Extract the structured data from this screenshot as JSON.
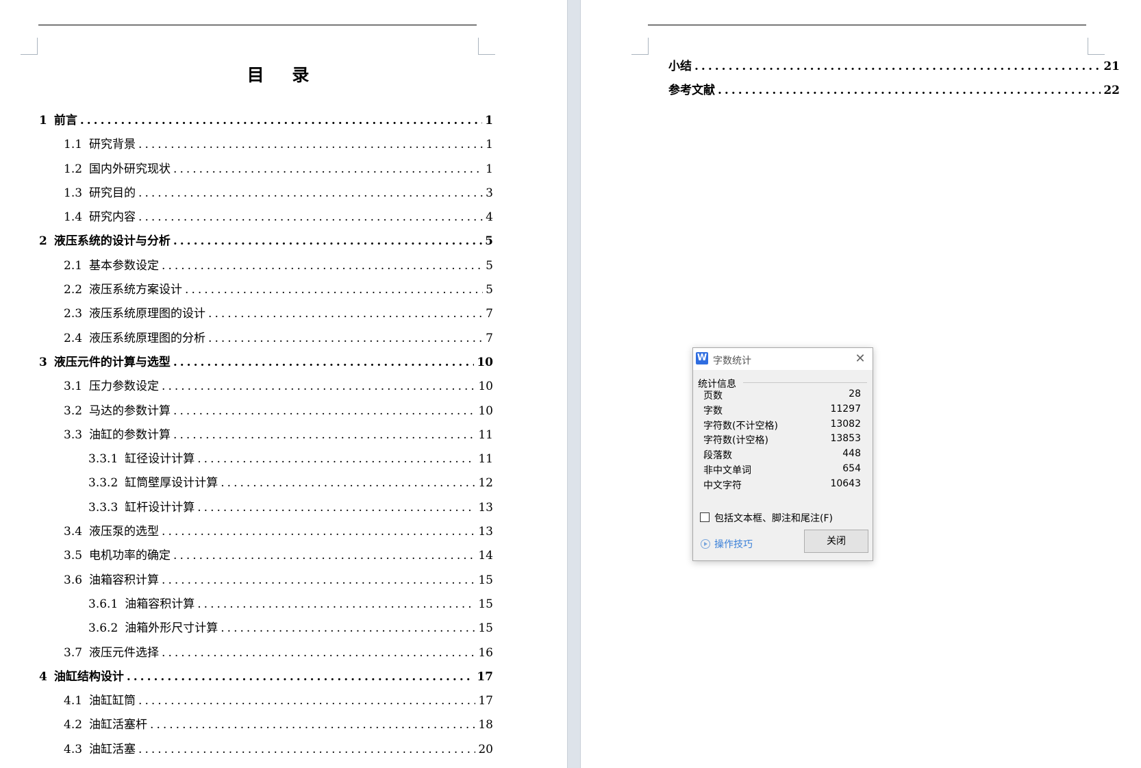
{
  "left_page": {
    "title": "目  录",
    "entries": [
      {
        "num": "1",
        "text": "前言",
        "page": "1",
        "level": 1
      },
      {
        "num": "1.1",
        "text": "研究背景",
        "page": "1",
        "level": 2
      },
      {
        "num": "1.2",
        "text": "国内外研究现状",
        "page": "1",
        "level": 2
      },
      {
        "num": "1.3",
        "text": "研究目的",
        "page": "3",
        "level": 2
      },
      {
        "num": "1.4",
        "text": "研究内容",
        "page": "4",
        "level": 2
      },
      {
        "num": "2",
        "text": "液压系统的设计与分析",
        "page": "5",
        "level": 1
      },
      {
        "num": "2.1",
        "text": "基本参数设定",
        "page": "5",
        "level": 2
      },
      {
        "num": "2.2",
        "text": "液压系统方案设计",
        "page": "5",
        "level": 2
      },
      {
        "num": "2.3",
        "text": "液压系统原理图的设计",
        "page": "7",
        "level": 2
      },
      {
        "num": "2.4",
        "text": "液压系统原理图的分析",
        "page": "7",
        "level": 2
      },
      {
        "num": "3",
        "text": "液压元件的计算与选型",
        "page": "10",
        "level": 1
      },
      {
        "num": "3.1",
        "text": "压力参数设定",
        "page": "10",
        "level": 2
      },
      {
        "num": "3.2",
        "text": "马达的参数计算",
        "page": "10",
        "level": 2
      },
      {
        "num": "3.3",
        "text": "油缸的参数计算",
        "page": "11",
        "level": 2
      },
      {
        "num": "3.3.1",
        "text": "缸径设计计算",
        "page": "11",
        "level": 3
      },
      {
        "num": "3.3.2",
        "text": "缸筒壁厚设计计算",
        "page": "12",
        "level": 3
      },
      {
        "num": "3.3.3",
        "text": "缸杆设计计算",
        "page": "13",
        "level": 3
      },
      {
        "num": "3.4",
        "text": "液压泵的选型",
        "page": "13",
        "level": 2
      },
      {
        "num": "3.5",
        "text": "电机功率的确定",
        "page": "14",
        "level": 2
      },
      {
        "num": "3.6",
        "text": "油箱容积计算",
        "page": "15",
        "level": 2
      },
      {
        "num": "3.6.1",
        "text": "油箱容积计算",
        "page": "15",
        "level": 3
      },
      {
        "num": "3.6.2",
        "text": "油箱外形尺寸计算",
        "page": "15",
        "level": 3
      },
      {
        "num": "3.7",
        "text": "液压元件选择",
        "page": "16",
        "level": 2
      },
      {
        "num": "4",
        "text": "油缸结构设计",
        "page": "17",
        "level": 1
      },
      {
        "num": "4.1",
        "text": "油缸缸筒",
        "page": "17",
        "level": 2
      },
      {
        "num": "4.2",
        "text": "油缸活塞杆",
        "page": "18",
        "level": 2
      },
      {
        "num": "4.3",
        "text": "油缸活塞",
        "page": "20",
        "level": 2
      }
    ]
  },
  "right_page": {
    "entries": [
      {
        "num": "",
        "text": "小结",
        "page": "21",
        "level": 1
      },
      {
        "num": "",
        "text": "参考文献",
        "page": "22",
        "level": 1
      }
    ]
  },
  "dialog": {
    "logo": "W",
    "title": "字数统计",
    "group_label": "统计信息",
    "stats": [
      {
        "label": "页数",
        "value": "28"
      },
      {
        "label": "字数",
        "value": "11297"
      },
      {
        "label": "字符数(不计空格)",
        "value": "13082"
      },
      {
        "label": "字符数(计空格)",
        "value": "13853"
      },
      {
        "label": "段落数",
        "value": "448"
      },
      {
        "label": "非中文单词",
        "value": "654"
      },
      {
        "label": "中文字符",
        "value": "10643"
      }
    ],
    "checkbox_label": "包括文本框、脚注和尾注(F)",
    "checkbox_checked": false,
    "tips_label": "操作技巧",
    "close_label": "关闭",
    "close_icon": "close-icon"
  }
}
